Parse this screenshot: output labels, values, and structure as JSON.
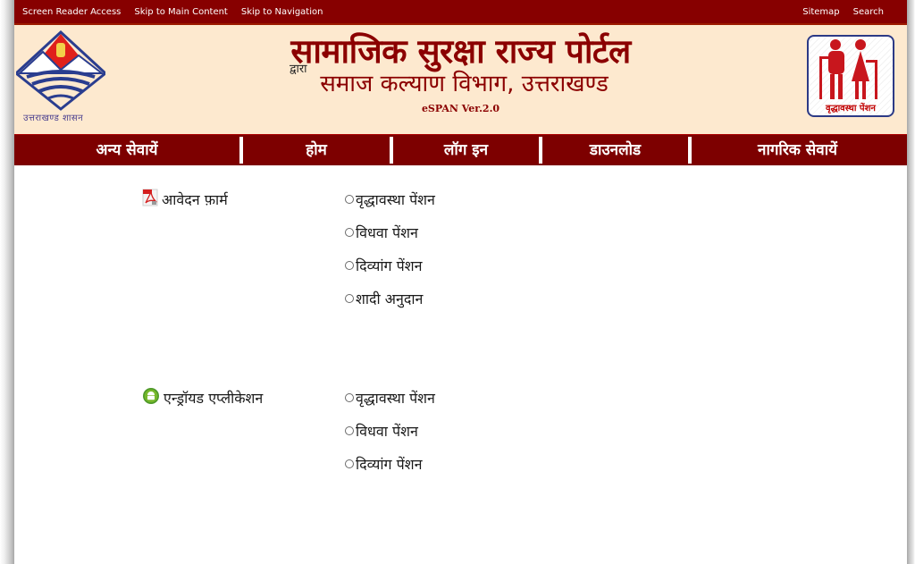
{
  "topbar": {
    "left_links": [
      "Screen Reader Access",
      "Skip to Main Content",
      "Skip to Navigation"
    ],
    "right_links": [
      "Sitemap",
      "Search"
    ]
  },
  "header": {
    "title": "सामाजिक सुरक्षा राज्य पोर्टल",
    "by": "द्वारा",
    "subtitle": "समाज कल्याण विभाग, उत्तराखण्ड",
    "version": "eSPAN Ver.2.0",
    "left_logo_caption": "उत्तराखण्ड शासन",
    "right_logo_caption": "वृद्धावस्था पेंशन"
  },
  "nav": {
    "items": [
      "अन्य सेवायें",
      "होम",
      "लॉग इन",
      "डाउनलोड",
      "नागरिक सेवायें"
    ]
  },
  "sections": [
    {
      "label": "आवेदन फ़ार्म",
      "icon": "pdf-icon",
      "options": [
        "वृद्धावस्था पेंशन",
        "विधवा पेंशन",
        "दिव्यांग पेंशन",
        "शादी अनुदान"
      ]
    },
    {
      "label": "एन्ड्रॉयड एप्लीकेशन",
      "icon": "android-icon",
      "options": [
        "वृद्धावस्था पेंशन",
        "विधवा पेंशन",
        "दिव्यांग पेंशन"
      ]
    }
  ],
  "colors": {
    "brand_maroon": "#870000",
    "header_bg": "#fde9cf",
    "nav_bg": "#7d0000"
  }
}
